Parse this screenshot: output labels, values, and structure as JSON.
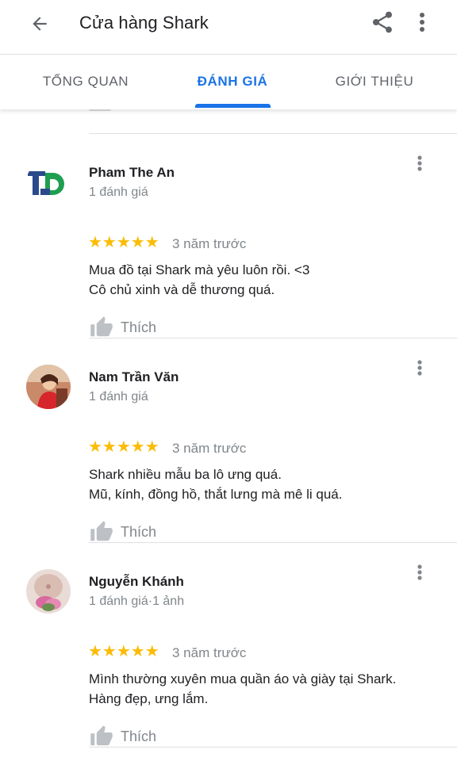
{
  "header": {
    "title": "Cửa hàng Shark",
    "back_icon": "arrow-back-icon",
    "share_icon": "share-icon",
    "more_icon": "more-vert-icon"
  },
  "tabs": [
    {
      "label": "TỔNG QUAN",
      "active": false
    },
    {
      "label": "ĐÁNH GIÁ",
      "active": true
    },
    {
      "label": "GIỚI THIỆU",
      "active": false
    }
  ],
  "colors": {
    "accent": "#1a73e8",
    "star": "#fbbc04",
    "secondary_text": "#80868b",
    "primary_text": "#202124",
    "divider": "#e0e0e0"
  },
  "reviews": [
    {
      "name": "Pham The An",
      "count": "1 đánh giá",
      "rating": 5,
      "stars": "★★★★★",
      "time": "3 năm trước",
      "text_line1": "Mua đồ tại Shark mà yêu luôn rồi. <3",
      "text_line2": "Cô chủ xinh và dễ thương quá.",
      "like_label": "Thích"
    },
    {
      "name": "Nam Trần Văn",
      "count": "1 đánh giá",
      "rating": 5,
      "stars": "★★★★★",
      "time": "3 năm trước",
      "text_line1": "Shark nhiều mẫu ba lô ưng quá.",
      "text_line2": "Mũ, kính, đồng hồ, thắt lưng mà mê li quá.",
      "like_label": "Thích"
    },
    {
      "name": "Nguyễn Khánh",
      "count": "1 đánh giá·1 ảnh",
      "rating": 5,
      "stars": "★★★★★",
      "time": "3 năm trước",
      "text_line1": "Mình thường xuyên mua quần áo và giày tại Shark.",
      "text_line2": "Hàng đẹp, ưng lắm.",
      "like_label": "Thích"
    }
  ]
}
